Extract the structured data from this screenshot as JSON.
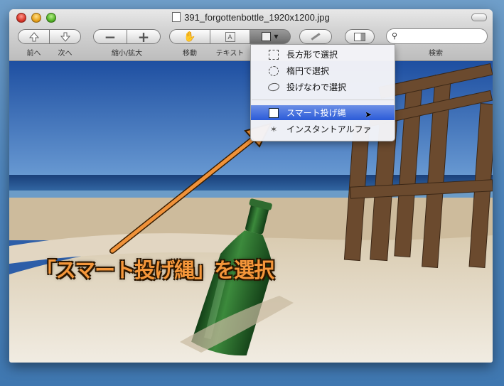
{
  "window": {
    "title": "391_forgottenbottle_1920x1200.jpg"
  },
  "toolbar": {
    "prev_label": "前へ",
    "next_label": "次へ",
    "zoom_label": "縮小/拡大",
    "move_label": "移動",
    "text_label": "テキスト",
    "search_label": "検索",
    "search_placeholder": ""
  },
  "menu": {
    "items": [
      {
        "label": "長方形で選択",
        "icon": "rect-select-icon"
      },
      {
        "label": "楕円で選択",
        "icon": "ellipse-select-icon"
      },
      {
        "label": "投げなわで選択",
        "icon": "lasso-icon"
      },
      {
        "label": "スマート投げ縄",
        "icon": "smart-lasso-icon",
        "selected": true
      },
      {
        "label": "インスタントアルファ",
        "icon": "magic-wand-icon"
      }
    ]
  },
  "annotation": {
    "text": "「スマート投げ縄」を選択",
    "color": "#f4963a"
  },
  "colors": {
    "menu_highlight": "#2b5bd8",
    "sky": "#2d5ea8",
    "sea": "#1f4d8a",
    "sand": "#e6dccb"
  }
}
